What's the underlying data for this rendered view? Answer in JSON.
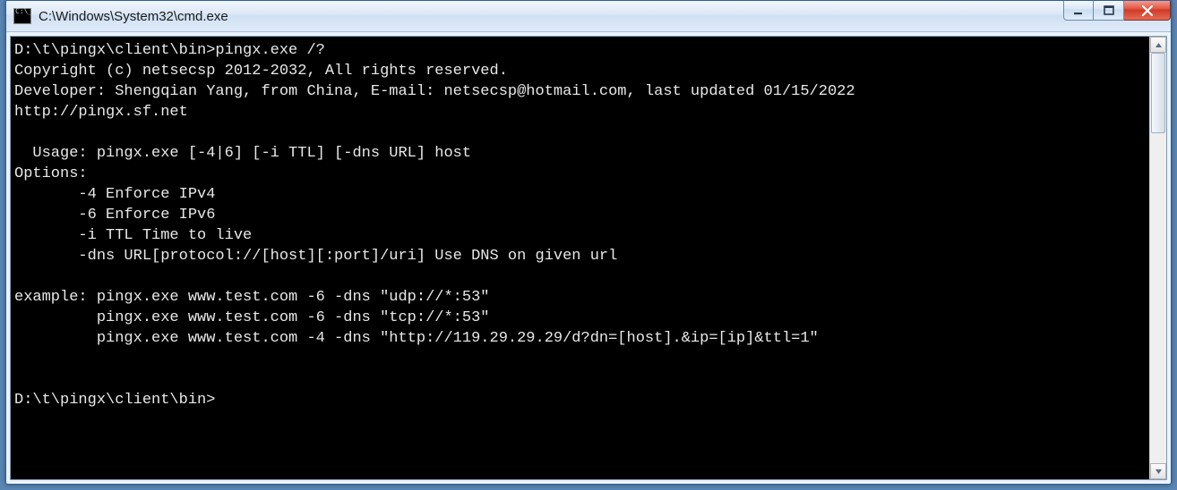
{
  "window": {
    "title": "C:\\Windows\\System32\\cmd.exe"
  },
  "console": {
    "lines": [
      "D:\\t\\pingx\\client\\bin>pingx.exe /?",
      "Copyright (c) netsecsp 2012-2032, All rights reserved.",
      "Developer: Shengqian Yang, from China, E-mail: netsecsp@hotmail.com, last updated 01/15/2022",
      "http://pingx.sf.net",
      "",
      "  Usage: pingx.exe [-4|6] [-i TTL] [-dns URL] host",
      "Options:",
      "       -4 Enforce IPv4",
      "       -6 Enforce IPv6",
      "       -i TTL Time to live",
      "       -dns URL[protocol://[host][:port]/uri] Use DNS on given url",
      "",
      "example: pingx.exe www.test.com -6 -dns \"udp://*:53\"",
      "         pingx.exe www.test.com -6 -dns \"tcp://*:53\"",
      "         pingx.exe www.test.com -4 -dns \"http://119.29.29.29/d?dn=[host].&ip=[ip]&ttl=1\"",
      "",
      "",
      "D:\\t\\pingx\\client\\bin>"
    ]
  }
}
